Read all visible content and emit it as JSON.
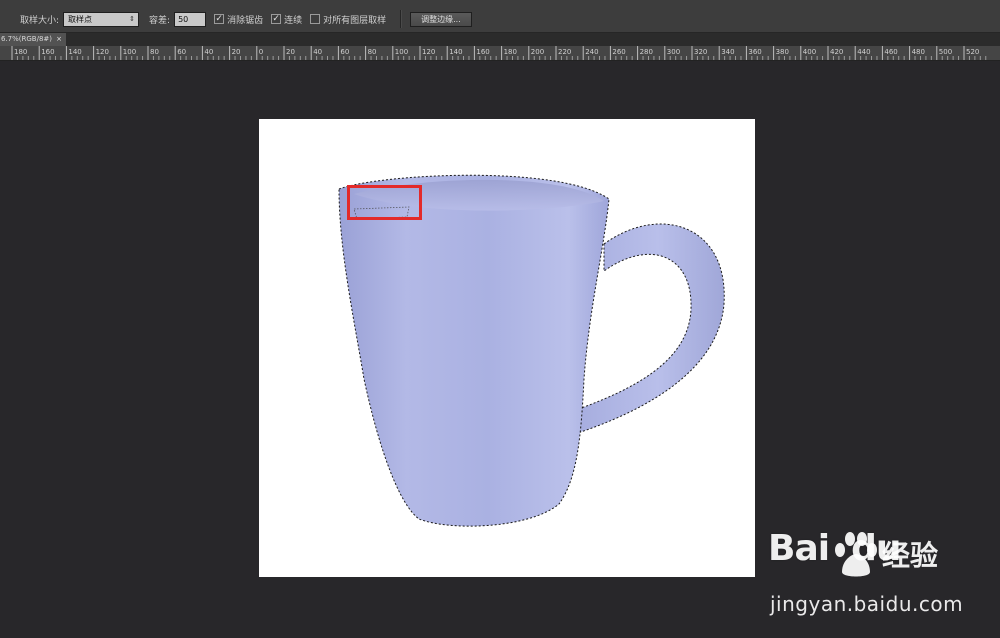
{
  "options_bar": {
    "sample_size_label": "取样大小:",
    "sample_size_value": "取样点",
    "tolerance_label": "容差:",
    "tolerance_value": "50",
    "anti_alias_label": "消除锯齿",
    "anti_alias_checked": "✓",
    "contiguous_label": "连续",
    "contiguous_checked": "✓",
    "sample_all_layers_label": "对所有图层取样",
    "refine_edge_button": "调整边缘..."
  },
  "document_tab": {
    "title": "6.7%(RGB/8#)",
    "close": "×"
  },
  "ruler": {
    "labels": [
      "180",
      "160",
      "140",
      "120",
      "100",
      "80",
      "60",
      "40",
      "20",
      "0",
      "20",
      "40",
      "60",
      "80",
      "100",
      "120",
      "140",
      "160",
      "180",
      "200",
      "220",
      "240",
      "260",
      "280",
      "300",
      "320",
      "340",
      "360",
      "380",
      "400",
      "420",
      "440",
      "460",
      "480",
      "500",
      "520"
    ]
  },
  "watermark": {
    "brand": "Bai",
    "brand_du": "du",
    "product": "经验",
    "url": "jingyan.baidu.com"
  },
  "colors": {
    "mug": "#a9b0e0",
    "selection_highlight": "#e32a2a"
  }
}
